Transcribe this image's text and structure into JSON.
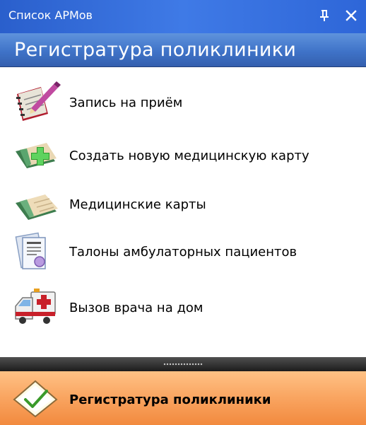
{
  "window": {
    "title": "Список АРМов",
    "pin_icon": "pin-icon",
    "close_icon": "close-icon"
  },
  "header": {
    "title": "Регистратура поликлиники"
  },
  "menu": {
    "items": [
      {
        "label": "Запись на приём",
        "icon": "appointment-book-icon"
      },
      {
        "label": "Создать новую медицинскую карту",
        "icon": "new-medical-card-icon"
      },
      {
        "label": "Медицинские карты",
        "icon": "medical-cards-icon"
      },
      {
        "label": "Талоны амбулаторных пациентов",
        "icon": "outpatient-coupons-icon"
      },
      {
        "label": "Вызов врача на дом",
        "icon": "ambulance-icon"
      }
    ]
  },
  "footer": {
    "label": "Регистратура поликлиники",
    "icon": "checkmark-diamond-icon"
  },
  "colors": {
    "titlebar": "#2e66d8",
    "header": "#3f73c8",
    "footer": "#f9a460",
    "splitter": "#2a2a2a"
  }
}
